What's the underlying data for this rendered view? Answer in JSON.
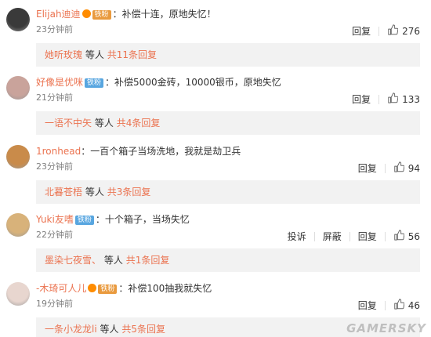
{
  "comments": [
    {
      "username": "Elijah迪迪",
      "badge": "铁粉",
      "badge_style": "gold",
      "vip": true,
      "text": "补偿十连，原地失忆！",
      "time": "23分钟前",
      "actions": [
        "回复"
      ],
      "likes": "276",
      "reply_user": "她听玫瑰",
      "reply_mid": "等人",
      "reply_count": "共11条回复",
      "avatar_color": "#3a3a3a"
    },
    {
      "username": "好像是优咪",
      "badge": "铁粉",
      "badge_style": "blue",
      "vip": false,
      "text": "补偿5000金砖，10000银币，原地失忆",
      "time": "21分钟前",
      "actions": [
        "回复"
      ],
      "likes": "133",
      "reply_user": "一语不中矢",
      "reply_mid": "等人",
      "reply_count": "共4条回复",
      "avatar_color": "#c9a39b"
    },
    {
      "username": "1ronhead",
      "badge": "",
      "badge_style": "",
      "vip": false,
      "text": "一百个箱子当场洗地，我就是劫卫兵",
      "time": "23分钟前",
      "actions": [
        "回复"
      ],
      "likes": "94",
      "reply_user": "北暮苍梧",
      "reply_mid": "等人",
      "reply_count": "共3条回复",
      "avatar_color": "#c98b4a"
    },
    {
      "username": "Yuki友嗜",
      "badge": "铁粉",
      "badge_style": "blue",
      "vip": false,
      "text": "十个箱子，当场失忆",
      "time": "22分钟前",
      "actions": [
        "投诉",
        "屏蔽",
        "回复"
      ],
      "likes": "56",
      "reply_user": "墨染七夜雪、",
      "reply_mid": "等人",
      "reply_count": "共1条回复",
      "avatar_color": "#d8b27a"
    },
    {
      "username": "-木琦可人儿",
      "badge": "铁粉",
      "badge_style": "gold",
      "vip": true,
      "text": "补偿100抽我就失忆",
      "time": "19分钟前",
      "actions": [
        "回复"
      ],
      "likes": "46",
      "reply_user": "一条小龙龙li",
      "reply_mid": "等人",
      "reply_count": "共5条回复",
      "avatar_color": "#e8d6cf"
    }
  ],
  "watermark": "GAMERSKY",
  "colors": {
    "accent": "#eb7350",
    "reply_bg": "#f2f2f2",
    "time": "#808080"
  }
}
